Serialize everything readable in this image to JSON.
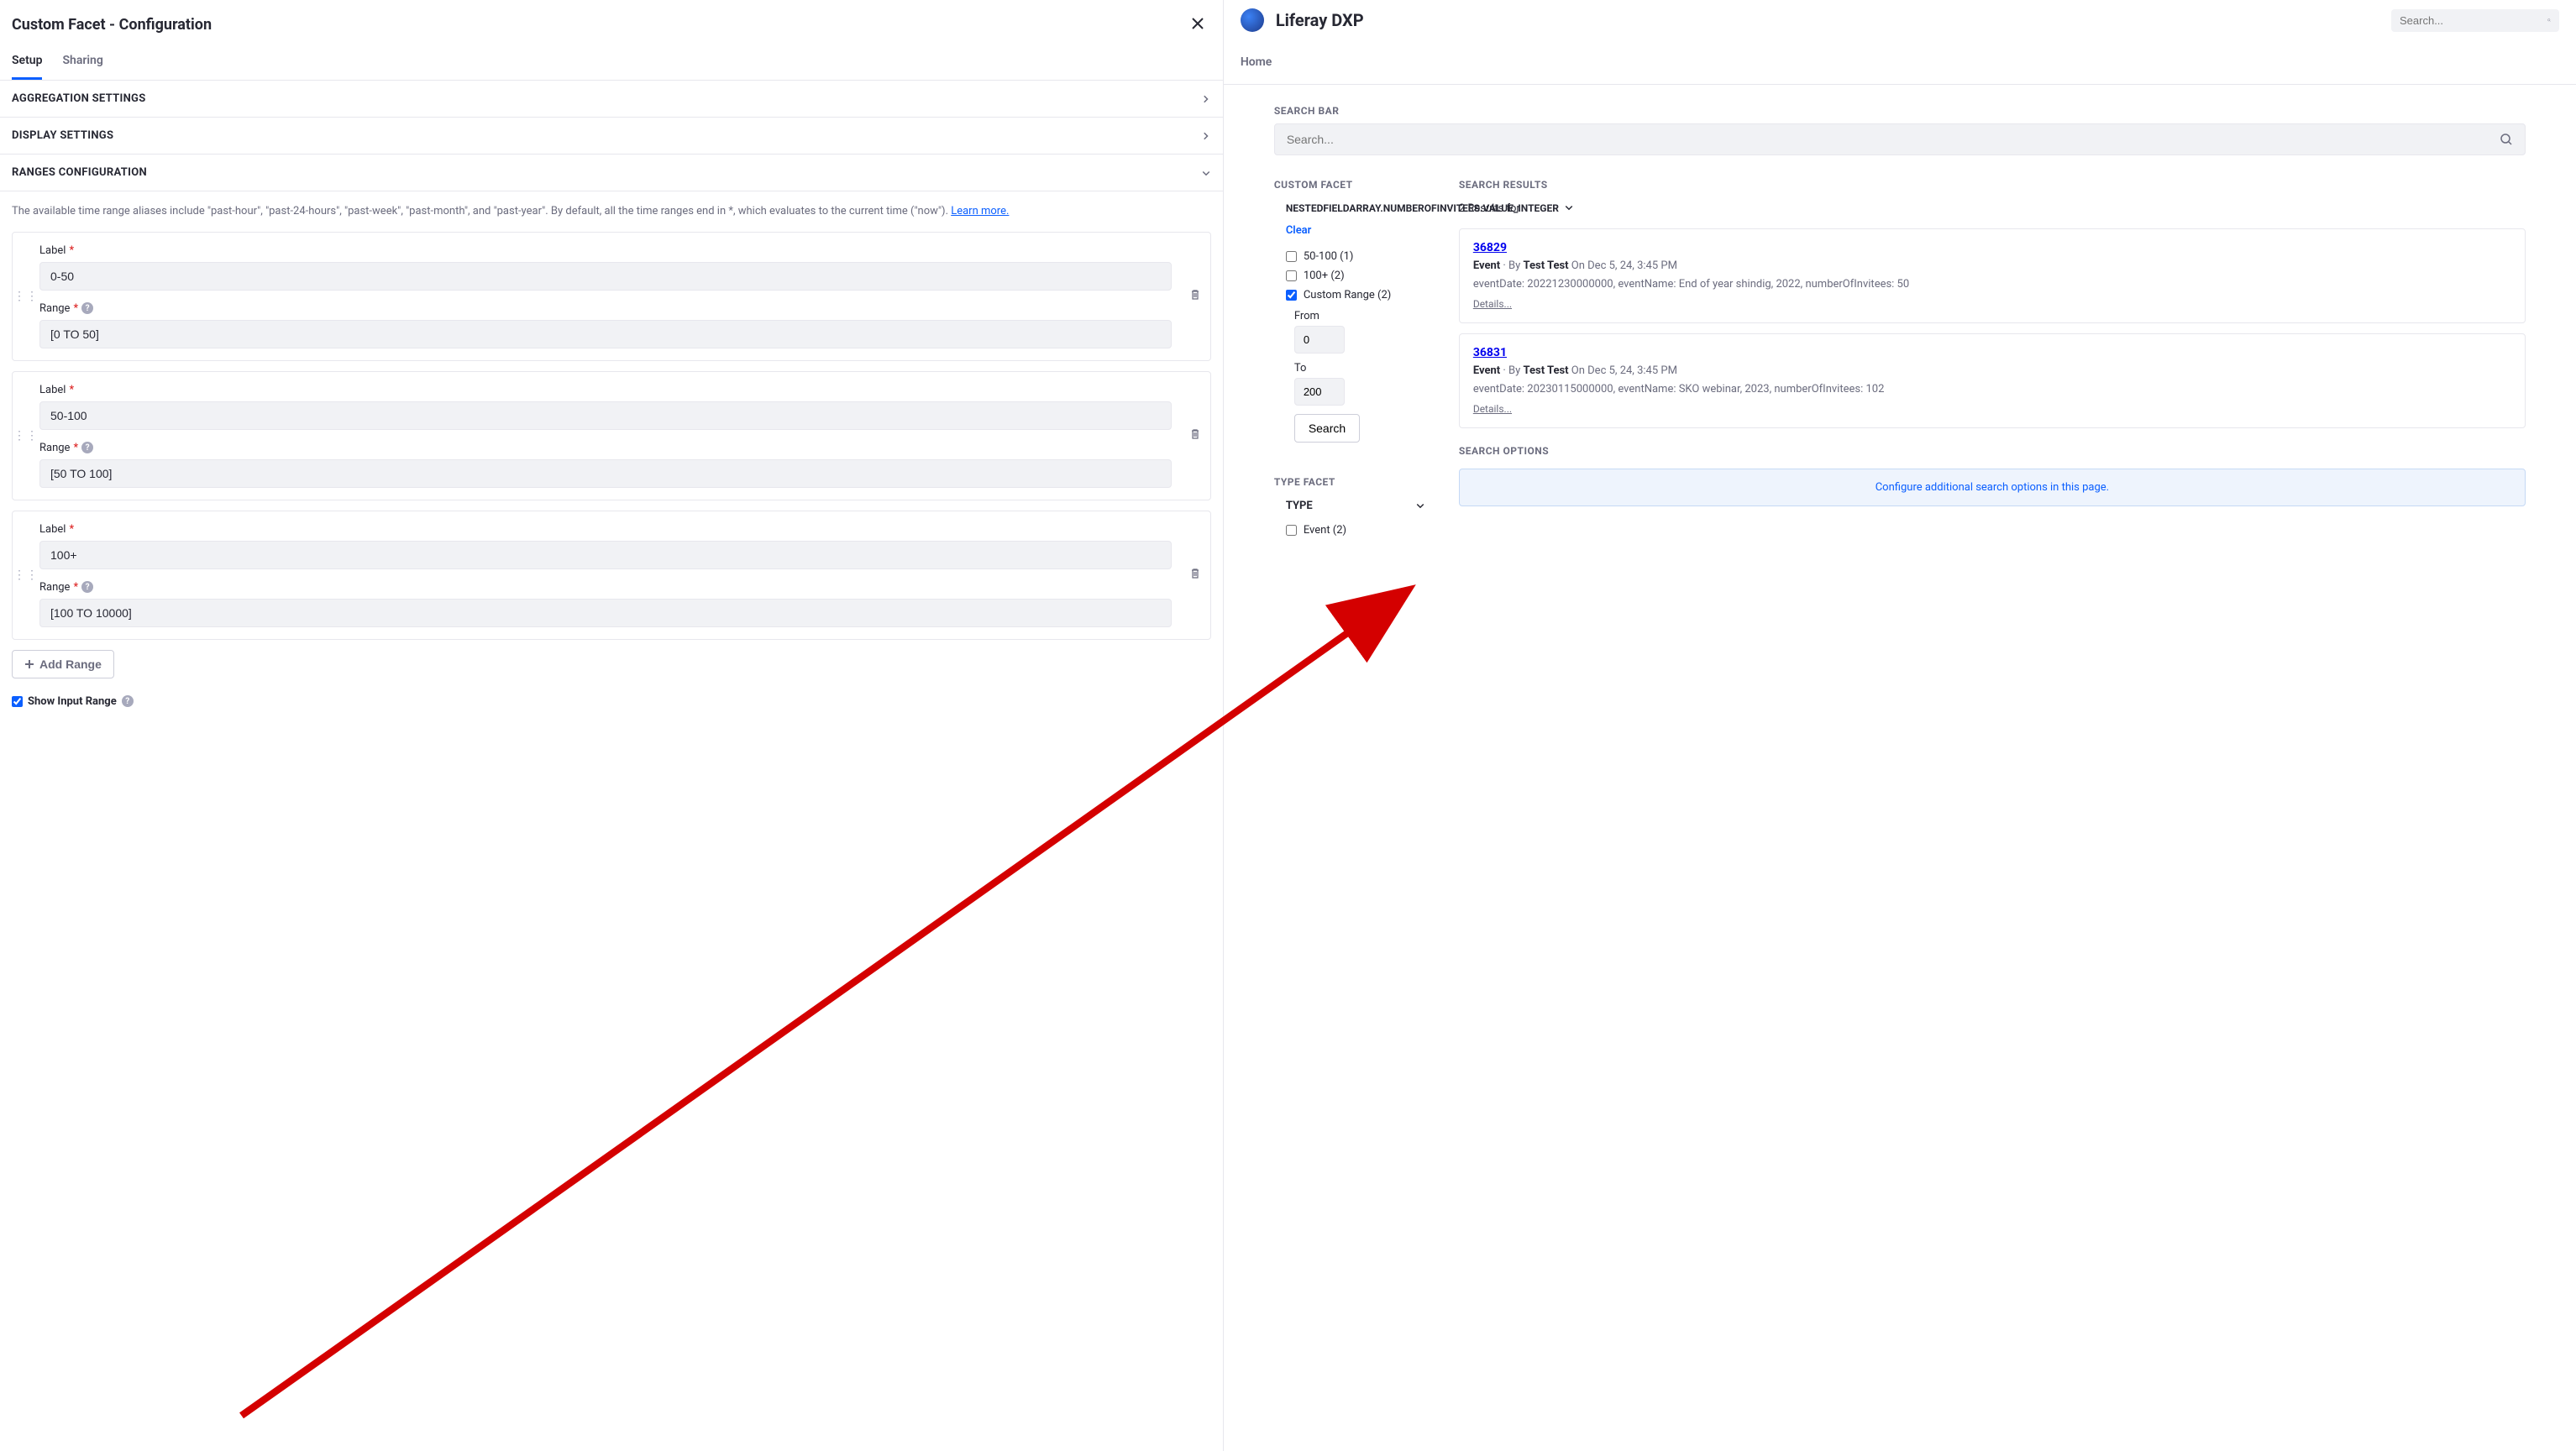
{
  "config": {
    "title": "Custom Facet - Configuration",
    "tabs": {
      "setup": "Setup",
      "sharing": "Sharing"
    },
    "sections": {
      "aggregation": "AGGREGATION SETTINGS",
      "display": "DISPLAY SETTINGS",
      "ranges": "RANGES CONFIGURATION"
    },
    "help": {
      "text1": "The available time range aliases include \"past-hour\", \"past-24-hours\", \"past-week\", \"past-month\", and \"past-year\". By default, all the time ranges end in *, which evaluates to the current time (\"now\"). ",
      "learn": "Learn more."
    },
    "labels": {
      "label": "Label",
      "range": "Range"
    },
    "ranges": [
      {
        "label": "0-50",
        "range": "[0 TO 50]"
      },
      {
        "label": "50-100",
        "range": "[50 TO 100]"
      },
      {
        "label": "100+",
        "range": "[100 TO 10000]"
      }
    ],
    "addRange": "Add Range",
    "showInput": "Show Input Range"
  },
  "app": {
    "brand": "Liferay DXP",
    "topSearchPlaceholder": "Search...",
    "home": "Home",
    "searchBarLabel": "SEARCH BAR",
    "searchPlaceholder": "Search...",
    "customFacet": {
      "title": "CUSTOM FACET",
      "field": "NESTEDFIELDARRAY.NUMBEROFINVITEES.VALUE_INTEGER",
      "clear": "Clear",
      "items": [
        {
          "label": "50-100 (1)",
          "checked": false
        },
        {
          "label": "100+ (2)",
          "checked": false
        },
        {
          "label": "Custom Range (2)",
          "checked": true
        }
      ],
      "fromLabel": "From",
      "fromValue": "0",
      "toLabel": "To",
      "toValue": "200",
      "searchBtn": "Search"
    },
    "typeFacet": {
      "title": "TYPE FACET",
      "header": "TYPE",
      "items": [
        {
          "label": "Event (2)"
        }
      ]
    },
    "results": {
      "title": "SEARCH RESULTS",
      "count": "2 Results for",
      "items": [
        {
          "id": "36829",
          "type": "Event",
          "by": "By",
          "author": "Test Test",
          "date": "On Dec 5, 24, 3:45 PM",
          "desc": "eventDate: 20221230000000, eventName: End of year shindig, 2022, numberOfInvitees: 50",
          "details": "Details..."
        },
        {
          "id": "36831",
          "type": "Event",
          "by": "By",
          "author": "Test Test",
          "date": "On Dec 5, 24, 3:45 PM",
          "desc": "eventDate: 20230115000000, eventName: SKO webinar, 2023, numberOfInvitees: 102",
          "details": "Details..."
        }
      ]
    },
    "searchOptions": {
      "title": "SEARCH OPTIONS",
      "link": "Configure additional search options in this page."
    }
  }
}
